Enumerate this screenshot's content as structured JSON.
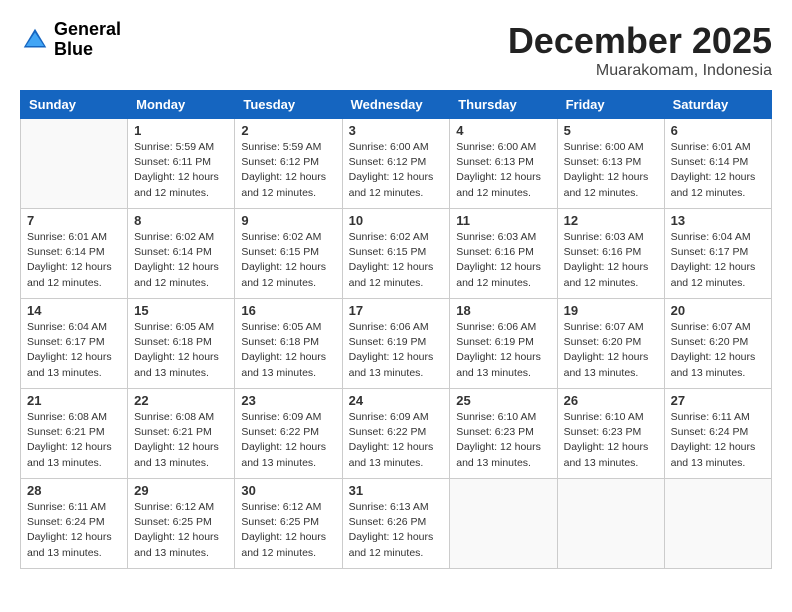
{
  "header": {
    "logo_general": "General",
    "logo_blue": "Blue",
    "month_title": "December 2025",
    "location": "Muarakomam, Indonesia"
  },
  "weekdays": [
    "Sunday",
    "Monday",
    "Tuesday",
    "Wednesday",
    "Thursday",
    "Friday",
    "Saturday"
  ],
  "weeks": [
    [
      {
        "day": "",
        "sunrise": "",
        "sunset": "",
        "daylight": ""
      },
      {
        "day": "1",
        "sunrise": "Sunrise: 5:59 AM",
        "sunset": "Sunset: 6:11 PM",
        "daylight": "Daylight: 12 hours and 12 minutes."
      },
      {
        "day": "2",
        "sunrise": "Sunrise: 5:59 AM",
        "sunset": "Sunset: 6:12 PM",
        "daylight": "Daylight: 12 hours and 12 minutes."
      },
      {
        "day": "3",
        "sunrise": "Sunrise: 6:00 AM",
        "sunset": "Sunset: 6:12 PM",
        "daylight": "Daylight: 12 hours and 12 minutes."
      },
      {
        "day": "4",
        "sunrise": "Sunrise: 6:00 AM",
        "sunset": "Sunset: 6:13 PM",
        "daylight": "Daylight: 12 hours and 12 minutes."
      },
      {
        "day": "5",
        "sunrise": "Sunrise: 6:00 AM",
        "sunset": "Sunset: 6:13 PM",
        "daylight": "Daylight: 12 hours and 12 minutes."
      },
      {
        "day": "6",
        "sunrise": "Sunrise: 6:01 AM",
        "sunset": "Sunset: 6:14 PM",
        "daylight": "Daylight: 12 hours and 12 minutes."
      }
    ],
    [
      {
        "day": "7",
        "sunrise": "Sunrise: 6:01 AM",
        "sunset": "Sunset: 6:14 PM",
        "daylight": "Daylight: 12 hours and 12 minutes."
      },
      {
        "day": "8",
        "sunrise": "Sunrise: 6:02 AM",
        "sunset": "Sunset: 6:14 PM",
        "daylight": "Daylight: 12 hours and 12 minutes."
      },
      {
        "day": "9",
        "sunrise": "Sunrise: 6:02 AM",
        "sunset": "Sunset: 6:15 PM",
        "daylight": "Daylight: 12 hours and 12 minutes."
      },
      {
        "day": "10",
        "sunrise": "Sunrise: 6:02 AM",
        "sunset": "Sunset: 6:15 PM",
        "daylight": "Daylight: 12 hours and 12 minutes."
      },
      {
        "day": "11",
        "sunrise": "Sunrise: 6:03 AM",
        "sunset": "Sunset: 6:16 PM",
        "daylight": "Daylight: 12 hours and 12 minutes."
      },
      {
        "day": "12",
        "sunrise": "Sunrise: 6:03 AM",
        "sunset": "Sunset: 6:16 PM",
        "daylight": "Daylight: 12 hours and 12 minutes."
      },
      {
        "day": "13",
        "sunrise": "Sunrise: 6:04 AM",
        "sunset": "Sunset: 6:17 PM",
        "daylight": "Daylight: 12 hours and 12 minutes."
      }
    ],
    [
      {
        "day": "14",
        "sunrise": "Sunrise: 6:04 AM",
        "sunset": "Sunset: 6:17 PM",
        "daylight": "Daylight: 12 hours and 13 minutes."
      },
      {
        "day": "15",
        "sunrise": "Sunrise: 6:05 AM",
        "sunset": "Sunset: 6:18 PM",
        "daylight": "Daylight: 12 hours and 13 minutes."
      },
      {
        "day": "16",
        "sunrise": "Sunrise: 6:05 AM",
        "sunset": "Sunset: 6:18 PM",
        "daylight": "Daylight: 12 hours and 13 minutes."
      },
      {
        "day": "17",
        "sunrise": "Sunrise: 6:06 AM",
        "sunset": "Sunset: 6:19 PM",
        "daylight": "Daylight: 12 hours and 13 minutes."
      },
      {
        "day": "18",
        "sunrise": "Sunrise: 6:06 AM",
        "sunset": "Sunset: 6:19 PM",
        "daylight": "Daylight: 12 hours and 13 minutes."
      },
      {
        "day": "19",
        "sunrise": "Sunrise: 6:07 AM",
        "sunset": "Sunset: 6:20 PM",
        "daylight": "Daylight: 12 hours and 13 minutes."
      },
      {
        "day": "20",
        "sunrise": "Sunrise: 6:07 AM",
        "sunset": "Sunset: 6:20 PM",
        "daylight": "Daylight: 12 hours and 13 minutes."
      }
    ],
    [
      {
        "day": "21",
        "sunrise": "Sunrise: 6:08 AM",
        "sunset": "Sunset: 6:21 PM",
        "daylight": "Daylight: 12 hours and 13 minutes."
      },
      {
        "day": "22",
        "sunrise": "Sunrise: 6:08 AM",
        "sunset": "Sunset: 6:21 PM",
        "daylight": "Daylight: 12 hours and 13 minutes."
      },
      {
        "day": "23",
        "sunrise": "Sunrise: 6:09 AM",
        "sunset": "Sunset: 6:22 PM",
        "daylight": "Daylight: 12 hours and 13 minutes."
      },
      {
        "day": "24",
        "sunrise": "Sunrise: 6:09 AM",
        "sunset": "Sunset: 6:22 PM",
        "daylight": "Daylight: 12 hours and 13 minutes."
      },
      {
        "day": "25",
        "sunrise": "Sunrise: 6:10 AM",
        "sunset": "Sunset: 6:23 PM",
        "daylight": "Daylight: 12 hours and 13 minutes."
      },
      {
        "day": "26",
        "sunrise": "Sunrise: 6:10 AM",
        "sunset": "Sunset: 6:23 PM",
        "daylight": "Daylight: 12 hours and 13 minutes."
      },
      {
        "day": "27",
        "sunrise": "Sunrise: 6:11 AM",
        "sunset": "Sunset: 6:24 PM",
        "daylight": "Daylight: 12 hours and 13 minutes."
      }
    ],
    [
      {
        "day": "28",
        "sunrise": "Sunrise: 6:11 AM",
        "sunset": "Sunset: 6:24 PM",
        "daylight": "Daylight: 12 hours and 13 minutes."
      },
      {
        "day": "29",
        "sunrise": "Sunrise: 6:12 AM",
        "sunset": "Sunset: 6:25 PM",
        "daylight": "Daylight: 12 hours and 13 minutes."
      },
      {
        "day": "30",
        "sunrise": "Sunrise: 6:12 AM",
        "sunset": "Sunset: 6:25 PM",
        "daylight": "Daylight: 12 hours and 12 minutes."
      },
      {
        "day": "31",
        "sunrise": "Sunrise: 6:13 AM",
        "sunset": "Sunset: 6:26 PM",
        "daylight": "Daylight: 12 hours and 12 minutes."
      },
      {
        "day": "",
        "sunrise": "",
        "sunset": "",
        "daylight": ""
      },
      {
        "day": "",
        "sunrise": "",
        "sunset": "",
        "daylight": ""
      },
      {
        "day": "",
        "sunrise": "",
        "sunset": "",
        "daylight": ""
      }
    ]
  ]
}
